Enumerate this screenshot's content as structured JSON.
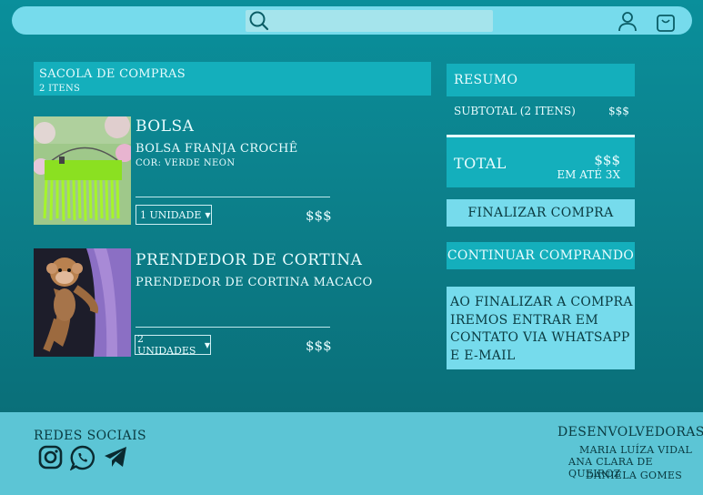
{
  "search": {
    "placeholder": ""
  },
  "cart": {
    "title": "SACOLA DE COMPRAS",
    "count": "2 ITENS",
    "items": [
      {
        "name": "BOLSA",
        "description": "BOLSA FRANJA CROCHÊ",
        "color": "COR: VERDE NEON",
        "quantity": "1 UNIDADE",
        "price": "$$$"
      },
      {
        "name": "PRENDEDOR DE CORTINA",
        "description": "PRENDEDOR DE CORTINA MACACO",
        "quantity": "2 UNIDADES",
        "price": "$$$"
      }
    ]
  },
  "summary": {
    "title": "RESUMO",
    "subtotal_label": "SUBTOTAL (2 ITENS)",
    "subtotal_value": "$$$",
    "total_label": "TOTAL",
    "total_value": "$$$",
    "installments": "EM ATÉ 3X",
    "finalize_label": "FINALIZAR COMPRA",
    "continue_label": "CONTINUAR COMPRANDO",
    "notice": "AO FINALIZAR A COMPRA IREMOS ENTRAR EM CONTATO VIA WHATSAPP E E-MAIL"
  },
  "footer": {
    "social_title": "REDES SOCIAIS",
    "social_icons": [
      "instagram-icon",
      "whatsapp-icon",
      "telegram-icon"
    ],
    "dev_title": "DESENVOLVEDORAS",
    "developers": [
      "MARIA LUÍZA VIDAL",
      "ANA CLARA DE QUEIROZ",
      "DANIELA GOMES"
    ]
  },
  "colors": {
    "topbar": "#76dbec",
    "panel": "#14afbc",
    "background": "#0c818c",
    "footer": "#5cc5d5"
  }
}
